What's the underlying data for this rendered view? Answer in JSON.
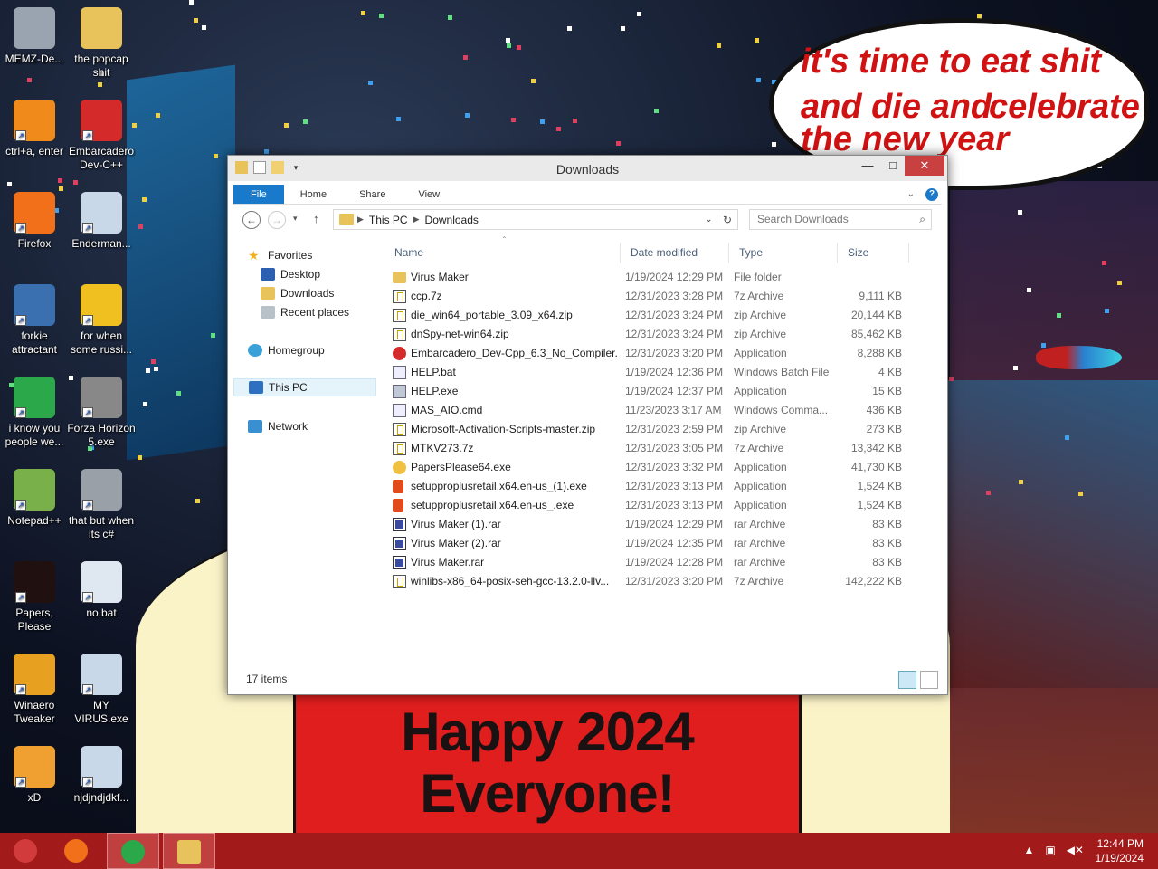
{
  "wallpaper": {
    "bubble_lines": [
      "it's time to eat shit",
      "and die and",
      "celebrate",
      "the new year"
    ],
    "sign_lines": [
      "Happy 2024",
      "Everyone!"
    ]
  },
  "desktop_icons": [
    {
      "label": "MEMZ-De...",
      "icon": "recycle-bin-icon",
      "color": "#9aa4b0"
    },
    {
      "label": "the popcap shit",
      "icon": "folder-icon",
      "color": "#e8c25b"
    },
    {
      "label": "ctrl+a, enter",
      "icon": "ring-icon",
      "color": "#f08a1a"
    },
    {
      "label": "Embarcadero Dev-C++",
      "icon": "devcpp-icon",
      "color": "#d52a2a"
    },
    {
      "label": "Firefox",
      "icon": "firefox-icon",
      "color": "#f3701a"
    },
    {
      "label": "Enderman...",
      "icon": "app-window-icon",
      "color": "#c8d8e8"
    },
    {
      "label": "forkie attractant",
      "icon": "settings-monitor-icon",
      "color": "#3a6fb0"
    },
    {
      "label": "for when some russi...",
      "icon": "de-icon",
      "color": "#f0c020"
    },
    {
      "label": "i know you people we...",
      "icon": "chrome-icon",
      "color": "#2aa84a"
    },
    {
      "label": "Forza Horizon 5.exe",
      "icon": "flash-icon",
      "color": "#888888"
    },
    {
      "label": "Notepad++",
      "icon": "notepad-icon",
      "color": "#7ab04a"
    },
    {
      "label": "that but when its c#",
      "icon": "files-icon",
      "color": "#9aa0a8"
    },
    {
      "label": "Papers, Please",
      "icon": "papers-please-icon",
      "color": "#201010"
    },
    {
      "label": "no.bat",
      "icon": "gear-doc-icon",
      "color": "#dfe8f0"
    },
    {
      "label": "Winaero Tweaker",
      "icon": "winaero-icon",
      "color": "#e8a020"
    },
    {
      "label": "MY VIRUS.exe",
      "icon": "app-window-icon",
      "color": "#c8d8e8"
    },
    {
      "label": "xD",
      "icon": "xd-icon",
      "color": "#f0a030"
    },
    {
      "label": "njdjndjdkf...",
      "icon": "app-window-icon",
      "color": "#c8d8e8"
    }
  ],
  "explorer": {
    "title": "Downloads",
    "ribbon_tabs": [
      "File",
      "Home",
      "Share",
      "View"
    ],
    "breadcrumb": [
      "This PC",
      "Downloads"
    ],
    "search_placeholder": "Search Downloads",
    "nav": {
      "favorites": "Favorites",
      "desktop": "Desktop",
      "downloads": "Downloads",
      "recent": "Recent places",
      "homegroup": "Homegroup",
      "thispc": "This PC",
      "network": "Network"
    },
    "columns": [
      "Name",
      "Date modified",
      "Type",
      "Size"
    ],
    "files": [
      {
        "name": "Virus Maker",
        "date": "1/19/2024 12:29 PM",
        "type": "File folder",
        "size": "",
        "icon": "folder"
      },
      {
        "name": "ccp.7z",
        "date": "12/31/2023 3:28 PM",
        "type": "7z Archive",
        "size": "9,111 KB",
        "icon": "archive"
      },
      {
        "name": "die_win64_portable_3.09_x64.zip",
        "date": "12/31/2023 3:24 PM",
        "type": "zip Archive",
        "size": "20,144 KB",
        "icon": "archive"
      },
      {
        "name": "dnSpy-net-win64.zip",
        "date": "12/31/2023 3:24 PM",
        "type": "zip Archive",
        "size": "85,462 KB",
        "icon": "archive"
      },
      {
        "name": "Embarcadero_Dev-Cpp_6.3_No_Compiler...",
        "date": "12/31/2023 3:20 PM",
        "type": "Application",
        "size": "8,288 KB",
        "icon": "dev"
      },
      {
        "name": "HELP.bat",
        "date": "1/19/2024 12:36 PM",
        "type": "Windows Batch File",
        "size": "4 KB",
        "icon": "bat"
      },
      {
        "name": "HELP.exe",
        "date": "1/19/2024 12:37 PM",
        "type": "Application",
        "size": "15 KB",
        "icon": "app"
      },
      {
        "name": "MAS_AIO.cmd",
        "date": "11/23/2023 3:17 AM",
        "type": "Windows Comma...",
        "size": "436 KB",
        "icon": "bat"
      },
      {
        "name": "Microsoft-Activation-Scripts-master.zip",
        "date": "12/31/2023 2:59 PM",
        "type": "zip Archive",
        "size": "273 KB",
        "icon": "archive"
      },
      {
        "name": "MTKV273.7z",
        "date": "12/31/2023 3:05 PM",
        "type": "7z Archive",
        "size": "13,342 KB",
        "icon": "archive"
      },
      {
        "name": "PapersPlease64.exe",
        "date": "12/31/2023 3:32 PM",
        "type": "Application",
        "size": "41,730 KB",
        "icon": "papers"
      },
      {
        "name": "setupproplusretail.x64.en-us_(1).exe",
        "date": "12/31/2023 3:13 PM",
        "type": "Application",
        "size": "1,524 KB",
        "icon": "office"
      },
      {
        "name": "setupproplusretail.x64.en-us_.exe",
        "date": "12/31/2023 3:13 PM",
        "type": "Application",
        "size": "1,524 KB",
        "icon": "office"
      },
      {
        "name": "Virus Maker (1).rar",
        "date": "1/19/2024 12:29 PM",
        "type": "rar Archive",
        "size": "83 KB",
        "icon": "rar"
      },
      {
        "name": "Virus Maker (2).rar",
        "date": "1/19/2024 12:35 PM",
        "type": "rar Archive",
        "size": "83 KB",
        "icon": "rar"
      },
      {
        "name": "Virus Maker.rar",
        "date": "1/19/2024 12:28 PM",
        "type": "rar Archive",
        "size": "83 KB",
        "icon": "rar"
      },
      {
        "name": "winlibs-x86_64-posix-seh-gcc-13.2.0-llv...",
        "date": "12/31/2023 3:20 PM",
        "type": "7z Archive",
        "size": "142,222 KB",
        "icon": "archive"
      }
    ],
    "status": "17 items"
  },
  "taskbar": {
    "apps": [
      {
        "icon": "start-icon",
        "color": "#d23b3b"
      },
      {
        "icon": "firefox-icon",
        "color": "#f3701a"
      },
      {
        "icon": "chrome-icon",
        "color": "#2aa84a"
      },
      {
        "icon": "file-explorer-icon",
        "color": "#e8c25b"
      }
    ],
    "time": "12:44 PM",
    "date": "1/19/2024"
  },
  "colors": {
    "accent": "#1979ca",
    "taskbar": "#a21a1a",
    "close": "#c84040"
  }
}
